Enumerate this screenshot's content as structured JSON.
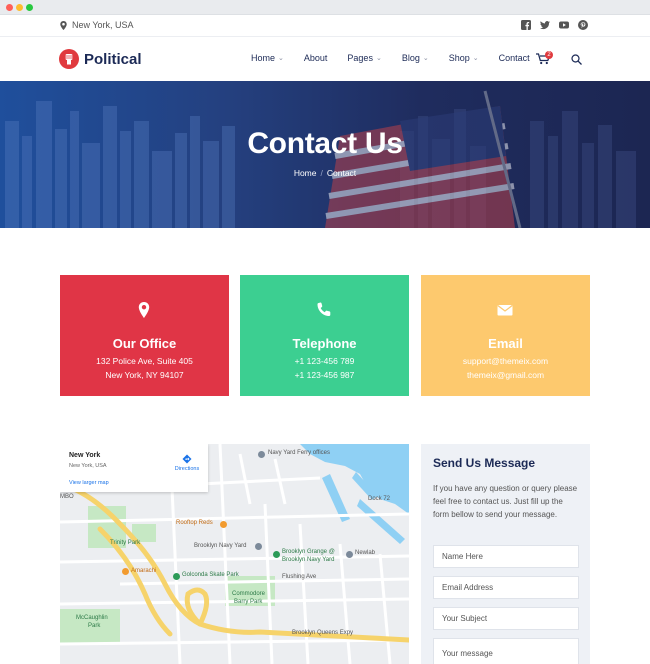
{
  "topbar": {
    "location": "New York, USA",
    "socials": [
      "facebook-icon",
      "twitter-icon",
      "youtube-icon",
      "pinterest-icon"
    ]
  },
  "nav": {
    "logo_text": "Political",
    "items": [
      {
        "label": "Home",
        "dropdown": true
      },
      {
        "label": "About",
        "dropdown": false
      },
      {
        "label": "Pages",
        "dropdown": true
      },
      {
        "label": "Blog",
        "dropdown": true
      },
      {
        "label": "Shop",
        "dropdown": true
      },
      {
        "label": "Contact",
        "dropdown": false
      }
    ],
    "cart_count": "2"
  },
  "hero": {
    "title": "Contact Us",
    "breadcrumb": [
      "Home",
      "Contact"
    ],
    "breadcrumb_sep": "/"
  },
  "cards": [
    {
      "title": "Our Office",
      "line1": "132 Police Ave, Suite 405",
      "line2": "New York, NY 94107",
      "color": "#e03546",
      "icon": "location-pin-icon"
    },
    {
      "title": "Telephone",
      "line1": "+1 123-456 789",
      "line2": "+1 123-456 987",
      "color": "#3ccf91",
      "icon": "phone-icon"
    },
    {
      "title": "Email",
      "line1": "support@themeix.com",
      "line2": "themeix@gmail.com",
      "color": "#fdc96e",
      "icon": "envelope-icon"
    }
  ],
  "map": {
    "card_title": "New York",
    "card_sub": "New York, USA",
    "card_link": "View larger map",
    "directions": "Directions",
    "labels": {
      "navy_yard": "Navy Yard Ferry offices",
      "dock": "Dock 72",
      "rooftop": "Rooftop Reds",
      "brooklyn_navy": "Brooklyn Navy Yard",
      "brooklyn_grange": "Brooklyn Grange @",
      "brooklyn_grange2": "Brooklyn Navy Yard",
      "newlab": "Newlab",
      "trinity": "Trinity Park",
      "amarachi": "Amarachi",
      "golconda": "Golconda Skate Park",
      "flushing": "Flushing Ave",
      "commodore": "Commodore",
      "barry": "Barry Park",
      "mccaughlin": "McCaughlin",
      "park": "Park",
      "bqe": "Brooklyn Queens Expy",
      "mbo": "MBO"
    }
  },
  "form": {
    "title": "Send Us Message",
    "description": "If you have any question or query please feel free to contact us. Just fill up the form bellow to send your message.",
    "placeholders": {
      "name": "Name Here",
      "email": "Email Address",
      "subject": "Your Subject",
      "message": "Your message"
    }
  }
}
